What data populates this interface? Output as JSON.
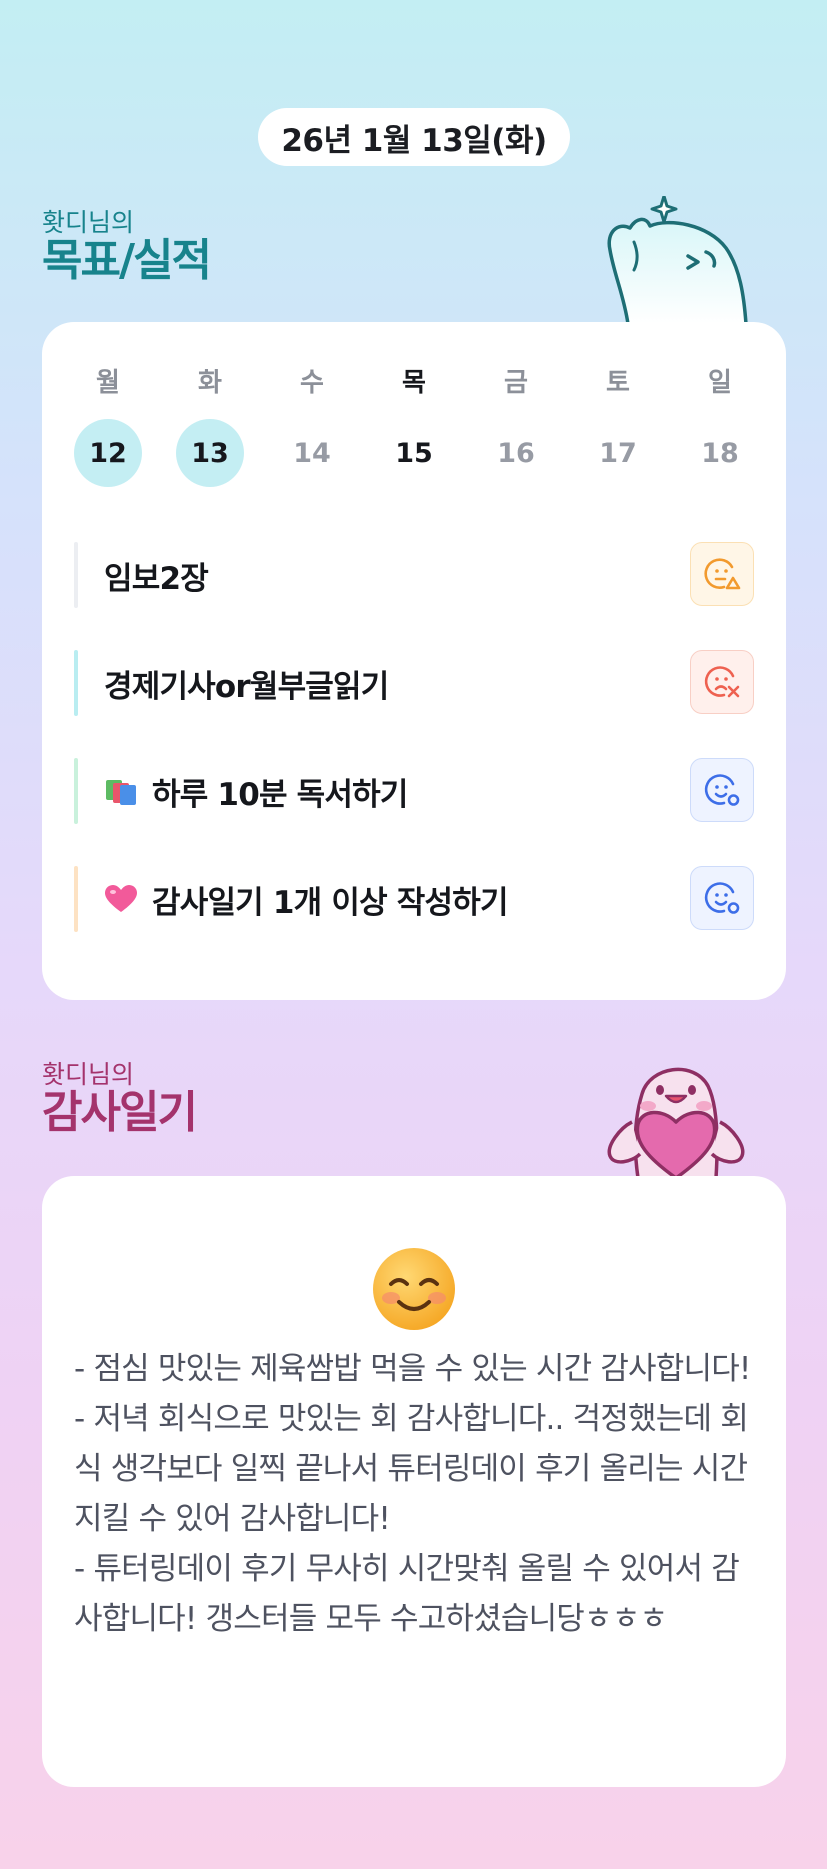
{
  "header": {
    "date": "26년 1월 13일(화)"
  },
  "goals_section": {
    "owner": "홧디님의",
    "title": "목표/실적",
    "weekdays": [
      "월",
      "화",
      "수",
      "목",
      "금",
      "토",
      "일"
    ],
    "dates": [
      "12",
      "13",
      "14",
      "15",
      "16",
      "17",
      "18"
    ],
    "completed_days": [
      "12",
      "13"
    ],
    "today_index": 3,
    "goals": [
      {
        "label": "임보2장",
        "emoji": "",
        "status_icon": "partial-face-triangle-icon",
        "accent": "#eceef2"
      },
      {
        "label": "경제기사or월부글읽기",
        "emoji": "",
        "status_icon": "fail-face-x-icon",
        "accent": "#b9edf1"
      },
      {
        "label": "하루 10분 독서하기",
        "emoji": "books-icon",
        "status_icon": "success-face-o-icon",
        "accent": "#c9f1dc"
      },
      {
        "label": "감사일기 1개 이상 작성하기",
        "emoji": "pink-heart-icon",
        "status_icon": "success-face-o-icon",
        "accent": "#fde2c3"
      }
    ]
  },
  "diary_section": {
    "owner": "홧디님의",
    "title": "감사일기",
    "mood_icon": "smiling-face-icon",
    "text": "- 점심 맛있는 제육쌈밥 먹을 수 있는 시간 감사합니다!\n- 저녁 회식으로 맛있는 회 감사합니다.. 걱정했는데 회식 생각보다 일찍 끝나서 튜터링데이 후기 올리는 시간 지킬 수 있어 감사합니다!\n- 튜터링데이 후기 무사히 시간맞춰 올릴 수 있어서 감사합니다! 갱스터들 모두 수고하셨습니당ㅎㅎㅎ"
  },
  "colors": {
    "goal_title": "#17838c",
    "diary_title": "#a4336c",
    "done_day": "#c4eef3",
    "partial": "#f29a2e",
    "fail": "#ee6150",
    "success": "#3d6ee8"
  }
}
